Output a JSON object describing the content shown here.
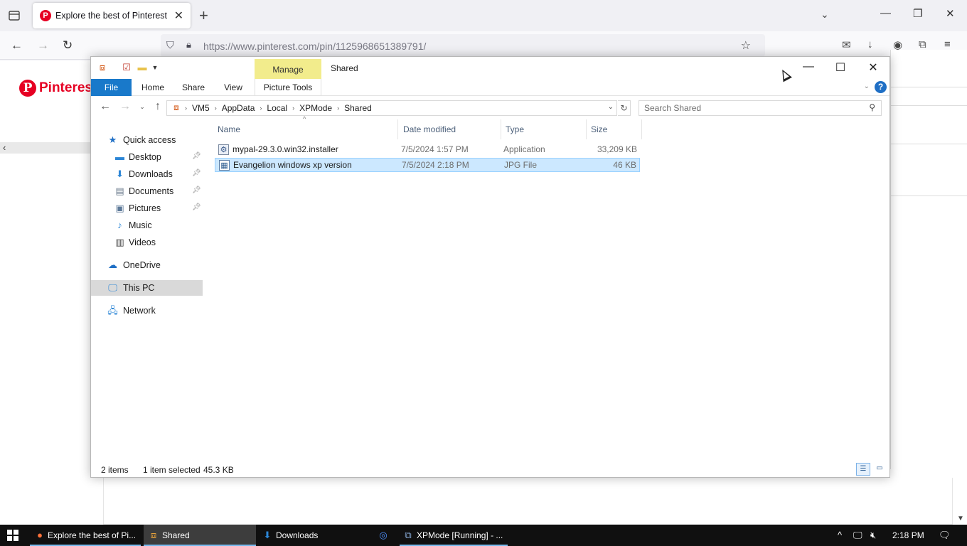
{
  "browser": {
    "tab_title": "Explore the best of Pinterest",
    "tab_favicon": "P",
    "url": "https://www.pinterest.com/pin/1125968651389791/",
    "site_logo_word": "Pinterest",
    "site_logo_letter": "P"
  },
  "explorer": {
    "window_title": "Shared",
    "contextual_tab_group": "Manage",
    "ribbon_tabs": {
      "file": "File",
      "home": "Home",
      "share": "Share",
      "view": "View",
      "picture_tools": "Picture Tools"
    },
    "breadcrumbs": [
      "VM5",
      "AppData",
      "Local",
      "XPMode",
      "Shared"
    ],
    "search_placeholder": "Search Shared",
    "nav": {
      "quick_access": "Quick access",
      "desktop": "Desktop",
      "downloads": "Downloads",
      "documents": "Documents",
      "pictures": "Pictures",
      "music": "Music",
      "videos": "Videos",
      "onedrive": "OneDrive",
      "this_pc": "This PC",
      "network": "Network"
    },
    "columns": {
      "name": "Name",
      "date": "Date modified",
      "type": "Type",
      "size": "Size"
    },
    "files": [
      {
        "name": "mypal-29.3.0.win32.installer",
        "date": "7/5/2024 1:57 PM",
        "type": "Application",
        "size": "33,209 KB"
      },
      {
        "name": "Evangelion windows xp version",
        "date": "7/5/2024 2:18 PM",
        "type": "JPG File",
        "size": "46 KB"
      }
    ],
    "status": {
      "item_count": "2 items",
      "selection": "1 item selected",
      "selection_size": "45.3 KB"
    }
  },
  "taskbar": {
    "items": [
      {
        "label": "Explore the best of Pi..."
      },
      {
        "label": "Shared"
      },
      {
        "label": "Downloads"
      },
      {
        "label": "XPMode [Running] - ..."
      }
    ],
    "clock": "2:18 PM"
  },
  "colors": {
    "pinterest_red": "#e60023",
    "ribbon_file_blue": "#1979ca",
    "manage_yellow": "#f2ec8c",
    "selection_blue": "#cce8ff"
  }
}
